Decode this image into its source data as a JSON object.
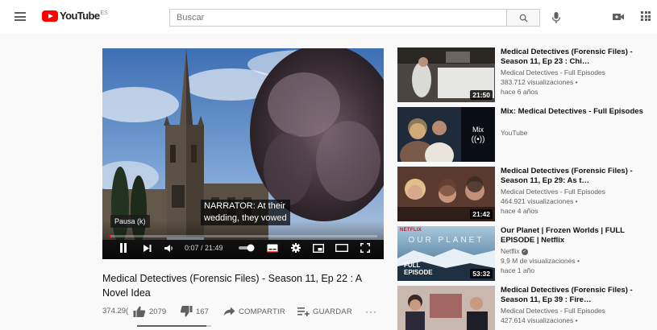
{
  "header": {
    "logo_text": "YouTube",
    "region": "ES",
    "search_placeholder": "Buscar"
  },
  "player": {
    "caption_line1": "NARRATOR: At their",
    "caption_line2": "wedding, they vowed",
    "tooltip": "Pausa (k)",
    "time": "0:07 / 21:49",
    "progress": 0.005
  },
  "video": {
    "title": "Medical Detectives (Forensic Files) - Season 11, Ep 22 : A Novel Idea",
    "views": "374.29(",
    "likes": "2079",
    "dislikes": "167",
    "share_label": "COMPARTIR",
    "save_label": "GUARDAR",
    "more_label": "···",
    "like_ratio": 0.93
  },
  "recommendations": [
    {
      "title": "Medical Detectives (Forensic Files) - Season 11, Ep 23 : Chi…",
      "channel": "Medical Detectives - Full Episodes",
      "views": "383.712 visualizaciones •",
      "age": "hace 6 años",
      "duration": "21:50"
    },
    {
      "title": "Mix: Medical Detectives - Full Episodes",
      "channel": "YouTube",
      "mix_label": "Mix",
      "mix_icon": "((•))"
    },
    {
      "title": "Medical Detectives (Forensic Files) - Season 11, Ep 29: As t…",
      "channel": "Medical Detectives - Full Episodes",
      "views": "464.921 visualizaciones •",
      "age": "hace 4 años",
      "duration": "21:42"
    },
    {
      "title": "Our Planet | Frozen Worlds | FULL EPISODE | Netflix",
      "channel": "Netflix",
      "verified_mark": "✓",
      "views": "9,9 M de visualizaciones •",
      "age": "hace 1 año",
      "duration": "53:32",
      "thumb_brand": "NETFLIX",
      "thumb_title": "OUR PLANET",
      "thumb_full1": "FULL",
      "thumb_full2": "EPISODE"
    },
    {
      "title": "Medical Detectives (Forensic Files) - Season 11, Ep 39 : Fire…",
      "channel": "Medical Detectives - Full Episodes",
      "views": "427.614 visualizaciones •"
    }
  ],
  "colors": {
    "brand_red": "#ff0000",
    "netflix_red": "#e50914",
    "text_secondary": "#606060"
  }
}
